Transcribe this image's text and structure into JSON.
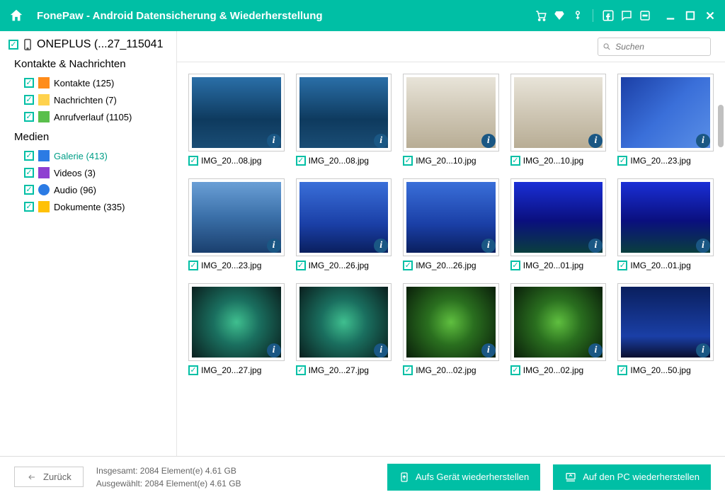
{
  "app_title": "FonePaw - Android Datensicherung & Wiederherstellung",
  "search_placeholder": "Suchen",
  "device_name": "ONEPLUS (...27_115041",
  "sections": {
    "contacts_msgs": {
      "title": "Kontakte & Nachrichten",
      "items": [
        {
          "label": "Kontakte (125)",
          "color": "#ff8c1a"
        },
        {
          "label": "Nachrichten (7)",
          "color": "#ffd24d"
        },
        {
          "label": "Anrufverlauf (1105)",
          "color": "#5abf4c"
        }
      ]
    },
    "media": {
      "title": "Medien",
      "items": [
        {
          "label": "Galerie (413)",
          "color": "#2b7be4",
          "active": true
        },
        {
          "label": "Videos (3)",
          "color": "#8e3fd1"
        },
        {
          "label": "Audio (96)",
          "color": "#2b7be4"
        },
        {
          "label": "Dokumente (335)",
          "color": "#ffc107"
        }
      ]
    }
  },
  "thumbnails": [
    {
      "label": "IMG_20...08.jpg",
      "bg": "linear-gradient(180deg,#2a6fa8 0%,#0e3a5e 60%,#1a4d75 100%)"
    },
    {
      "label": "IMG_20...08.jpg",
      "bg": "linear-gradient(180deg,#2a6fa8 0%,#0e3a5e 60%,#1a4d75 100%)"
    },
    {
      "label": "IMG_20...10.jpg",
      "bg": "linear-gradient(180deg,#e8e4d9 0%,#cfc7b5 50%,#b8ad95 100%)"
    },
    {
      "label": "IMG_20...10.jpg",
      "bg": "linear-gradient(180deg,#e8e4d9 0%,#cfc7b5 50%,#b8ad95 100%)"
    },
    {
      "label": "IMG_20...23.jpg",
      "bg": "linear-gradient(135deg,#1b3fa6 0%,#3a6fd9 50%,#5a8fe6 100%)"
    },
    {
      "label": "IMG_20...23.jpg",
      "bg": "linear-gradient(180deg,#6a9fd6 0%,#3a6fa8 50%,#1a3f6e 100%)"
    },
    {
      "label": "IMG_20...26.jpg",
      "bg": "linear-gradient(180deg,#3a6fd9 0%,#1a3fa6 60%,#0a1f5e 100%)"
    },
    {
      "label": "IMG_20...26.jpg",
      "bg": "linear-gradient(180deg,#3a6fd9 0%,#1a3fa6 60%,#0a1f5e 100%)"
    },
    {
      "label": "IMG_20...01.jpg",
      "bg": "linear-gradient(180deg,#1a2fd6 0%,#0a0f7e 55%,#0a3f3e 100%)"
    },
    {
      "label": "IMG_20...01.jpg",
      "bg": "linear-gradient(180deg,#1a2fd6 0%,#0a0f7e 55%,#0a3f3e 100%)"
    },
    {
      "label": "IMG_20...27.jpg",
      "bg": "radial-gradient(circle,#3fbf8f 0%,#1a6f5f 40%,#0a1f1e 100%)"
    },
    {
      "label": "IMG_20...27.jpg",
      "bg": "radial-gradient(circle,#3fbf8f 0%,#1a6f5f 40%,#0a1f1e 100%)"
    },
    {
      "label": "IMG_20...02.jpg",
      "bg": "radial-gradient(circle,#5fbf3f 0%,#2a6f1f 40%,#0a1f0a 100%)"
    },
    {
      "label": "IMG_20...02.jpg",
      "bg": "radial-gradient(circle,#5fbf3f 0%,#2a6f1f 40%,#0a1f0a 100%)"
    },
    {
      "label": "IMG_20...50.jpg",
      "bg": "linear-gradient(180deg,#0a1f5e 0%,#1a3fa6 70%,#0a0f2e 100%)"
    }
  ],
  "footer": {
    "back": "Zurück",
    "total_label": "Insgesamt:",
    "total_value": "2084 Element(e) 4.61 GB",
    "selected_label": "Ausgewählt:",
    "selected_value": "2084 Element(e) 4.61 GB",
    "restore_device": "Aufs Gerät wiederherstellen",
    "restore_pc": "Auf den PC wiederherstellen"
  }
}
